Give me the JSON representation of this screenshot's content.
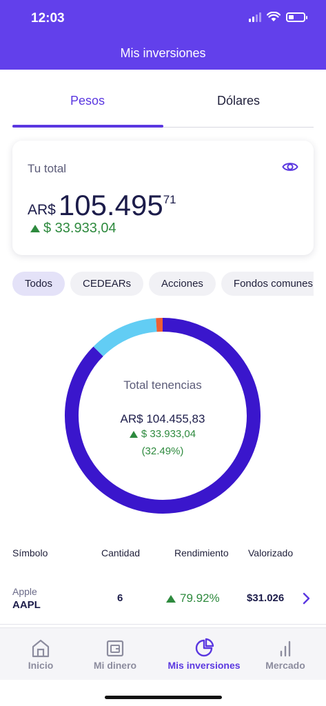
{
  "status_bar": {
    "time": "12:03"
  },
  "header": {
    "title": "Mis inversiones"
  },
  "tabs": [
    {
      "label": "Pesos",
      "active": true
    },
    {
      "label": "Dólares",
      "active": false
    }
  ],
  "total_card": {
    "label": "Tu total",
    "currency": "AR$",
    "amount_int": "105.495",
    "amount_dec": "71",
    "gain": "$ 33.933,04"
  },
  "filters": [
    {
      "label": "Todos",
      "active": true
    },
    {
      "label": "CEDEARs",
      "active": false
    },
    {
      "label": "Acciones",
      "active": false
    },
    {
      "label": "Fondos comunes",
      "active": false
    }
  ],
  "holdings_chart": {
    "title": "Total tenencias",
    "amount": "AR$ 104.455,83",
    "gain": "$ 33.933,04",
    "percent": "(32.49%)"
  },
  "chart_data": {
    "type": "pie",
    "values": [
      87.5,
      11.4,
      1.1
    ],
    "colors": [
      "#3a16cc",
      "#62cdf4",
      "#ee5f33"
    ]
  },
  "table": {
    "headers": {
      "symbol": "Símbolo",
      "quantity": "Cantidad",
      "performance": "Rendimiento",
      "value": "Valorizado"
    },
    "rows": [
      {
        "name": "Apple",
        "symbol": "AAPL",
        "quantity": "6",
        "performance": "79.92%",
        "value": "$31.026"
      }
    ]
  },
  "bottom_nav": [
    {
      "label": "Inicio",
      "icon": "home-icon",
      "active": false
    },
    {
      "label": "Mi dinero",
      "icon": "wallet-icon",
      "active": false
    },
    {
      "label": "Mis inversiones",
      "icon": "pie-chart-icon",
      "active": true
    },
    {
      "label": "Mercado",
      "icon": "bar-chart-icon",
      "active": false
    }
  ],
  "colors": {
    "primary": "#6240eb",
    "accent": "#5a37e0",
    "positive": "#2e8a3e"
  }
}
